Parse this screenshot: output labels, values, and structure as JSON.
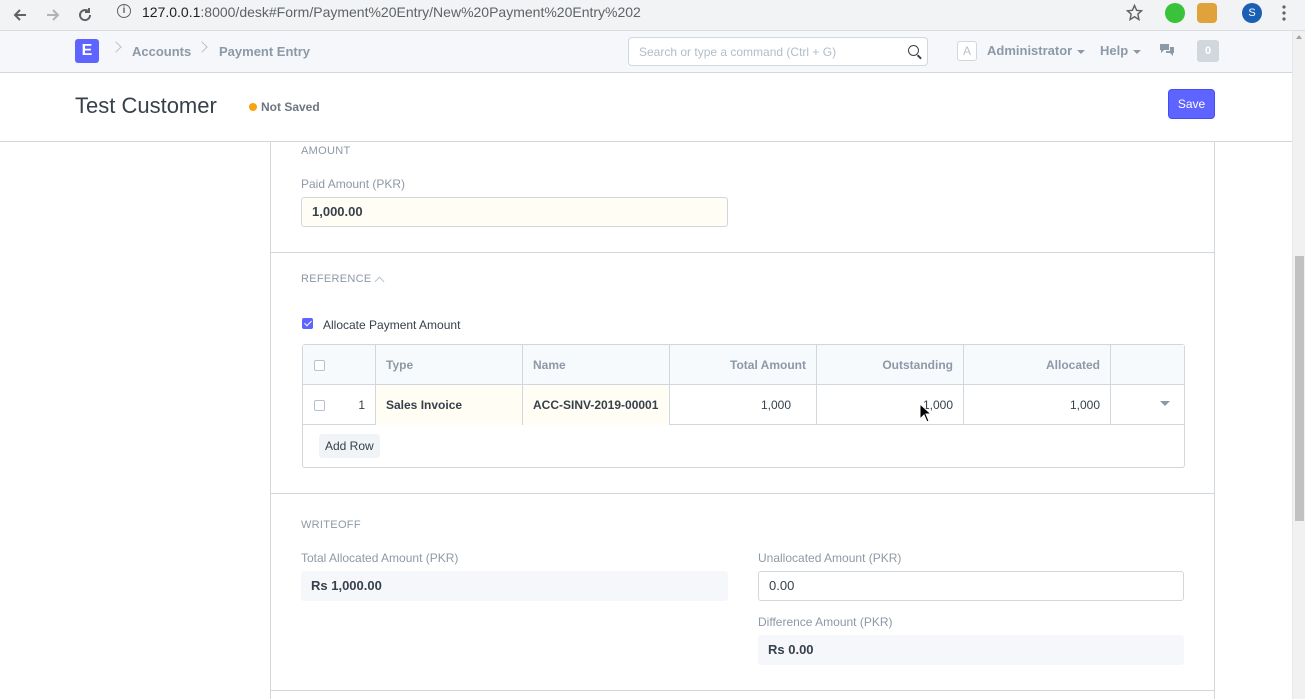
{
  "browser": {
    "url_host": "127.0.0.1",
    "url_path": ":8000/desk#Form/Payment%20Entry/New%20Payment%20Entry%202",
    "profile_initial": "S"
  },
  "navbar": {
    "logo_letter": "E",
    "breadcrumbs": [
      "Accounts",
      "Payment Entry"
    ],
    "search_placeholder": "Search or type a command (Ctrl + G)",
    "avatar_letter": "A",
    "user_menu": "Administrator",
    "help_menu": "Help",
    "notification_count": "0"
  },
  "page": {
    "title": "Test Customer",
    "status": "Not Saved",
    "save_label": "Save"
  },
  "amount_section": {
    "heading": "AMOUNT",
    "paid_amount_label": "Paid Amount (PKR)",
    "paid_amount_value": "1,000.00"
  },
  "reference_section": {
    "heading": "REFERENCE",
    "allocate_label": "Allocate Payment Amount",
    "allocate_checked": true,
    "columns": [
      "Type",
      "Name",
      "Total Amount",
      "Outstanding",
      "Allocated"
    ],
    "rows": [
      {
        "idx": "1",
        "type": "Sales Invoice",
        "name": "ACC-SINV-2019-00001",
        "total_amount": "1,000",
        "outstanding": "1,000",
        "allocated": "1,000"
      }
    ],
    "add_row_label": "Add Row"
  },
  "writeoff_section": {
    "heading": "WRITEOFF",
    "total_allocated_label": "Total Allocated Amount (PKR)",
    "total_allocated_value": "Rs 1,000.00",
    "unallocated_label": "Unallocated Amount (PKR)",
    "unallocated_value": "0.00",
    "difference_label": "Difference Amount (PKR)",
    "difference_value": "Rs 0.00"
  },
  "colors": {
    "accent": "#5e64ff",
    "status_dot": "#f8a30f"
  }
}
